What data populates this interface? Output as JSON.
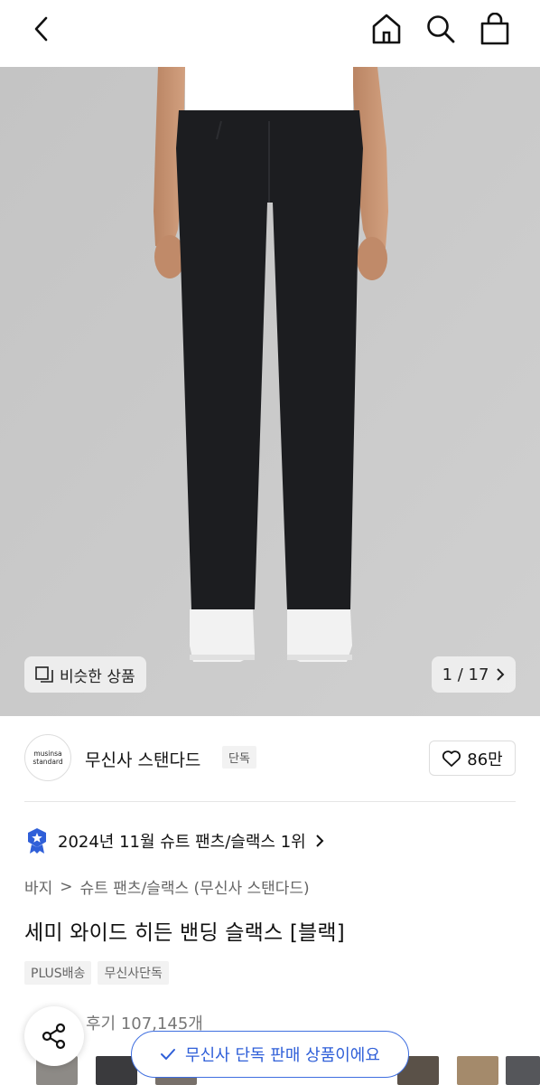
{
  "header": {
    "back_icon": "chevron-left-icon",
    "home_icon": "home-icon",
    "search_icon": "search-icon",
    "cart_icon": "shopping-bag-icon"
  },
  "gallery": {
    "similar_label": "비슷한 상품",
    "pager": "1 / 17",
    "colors": {
      "background": "#c9c9c9",
      "pants": "#1c1d20",
      "shoes": "#f2f2f2",
      "shirt": "#ffffff"
    }
  },
  "brand": {
    "logo_line1": "musinsa",
    "logo_line2": "standard",
    "name": "무신사 스탠다드",
    "tag": "단독",
    "likes": "86만"
  },
  "ranking": {
    "text": "2024년 11월 슈트 팬츠/슬랙스 1위",
    "badge_color": "#2f5fd8"
  },
  "breadcrumb": {
    "level1": "바지",
    "separator": ">",
    "level2": "슈트 팬츠/슬랙스 (무신사 스탠다드)"
  },
  "product": {
    "title": "세미 와이드 히든 밴딩 슬랙스 [블랙]",
    "chips": [
      "PLUS배송",
      "무신사단독"
    ]
  },
  "review": {
    "text": "후기 107,145개"
  },
  "toast": {
    "text": "무신사 단독 판매 상품이에요",
    "accent": "#2f5fd8"
  }
}
